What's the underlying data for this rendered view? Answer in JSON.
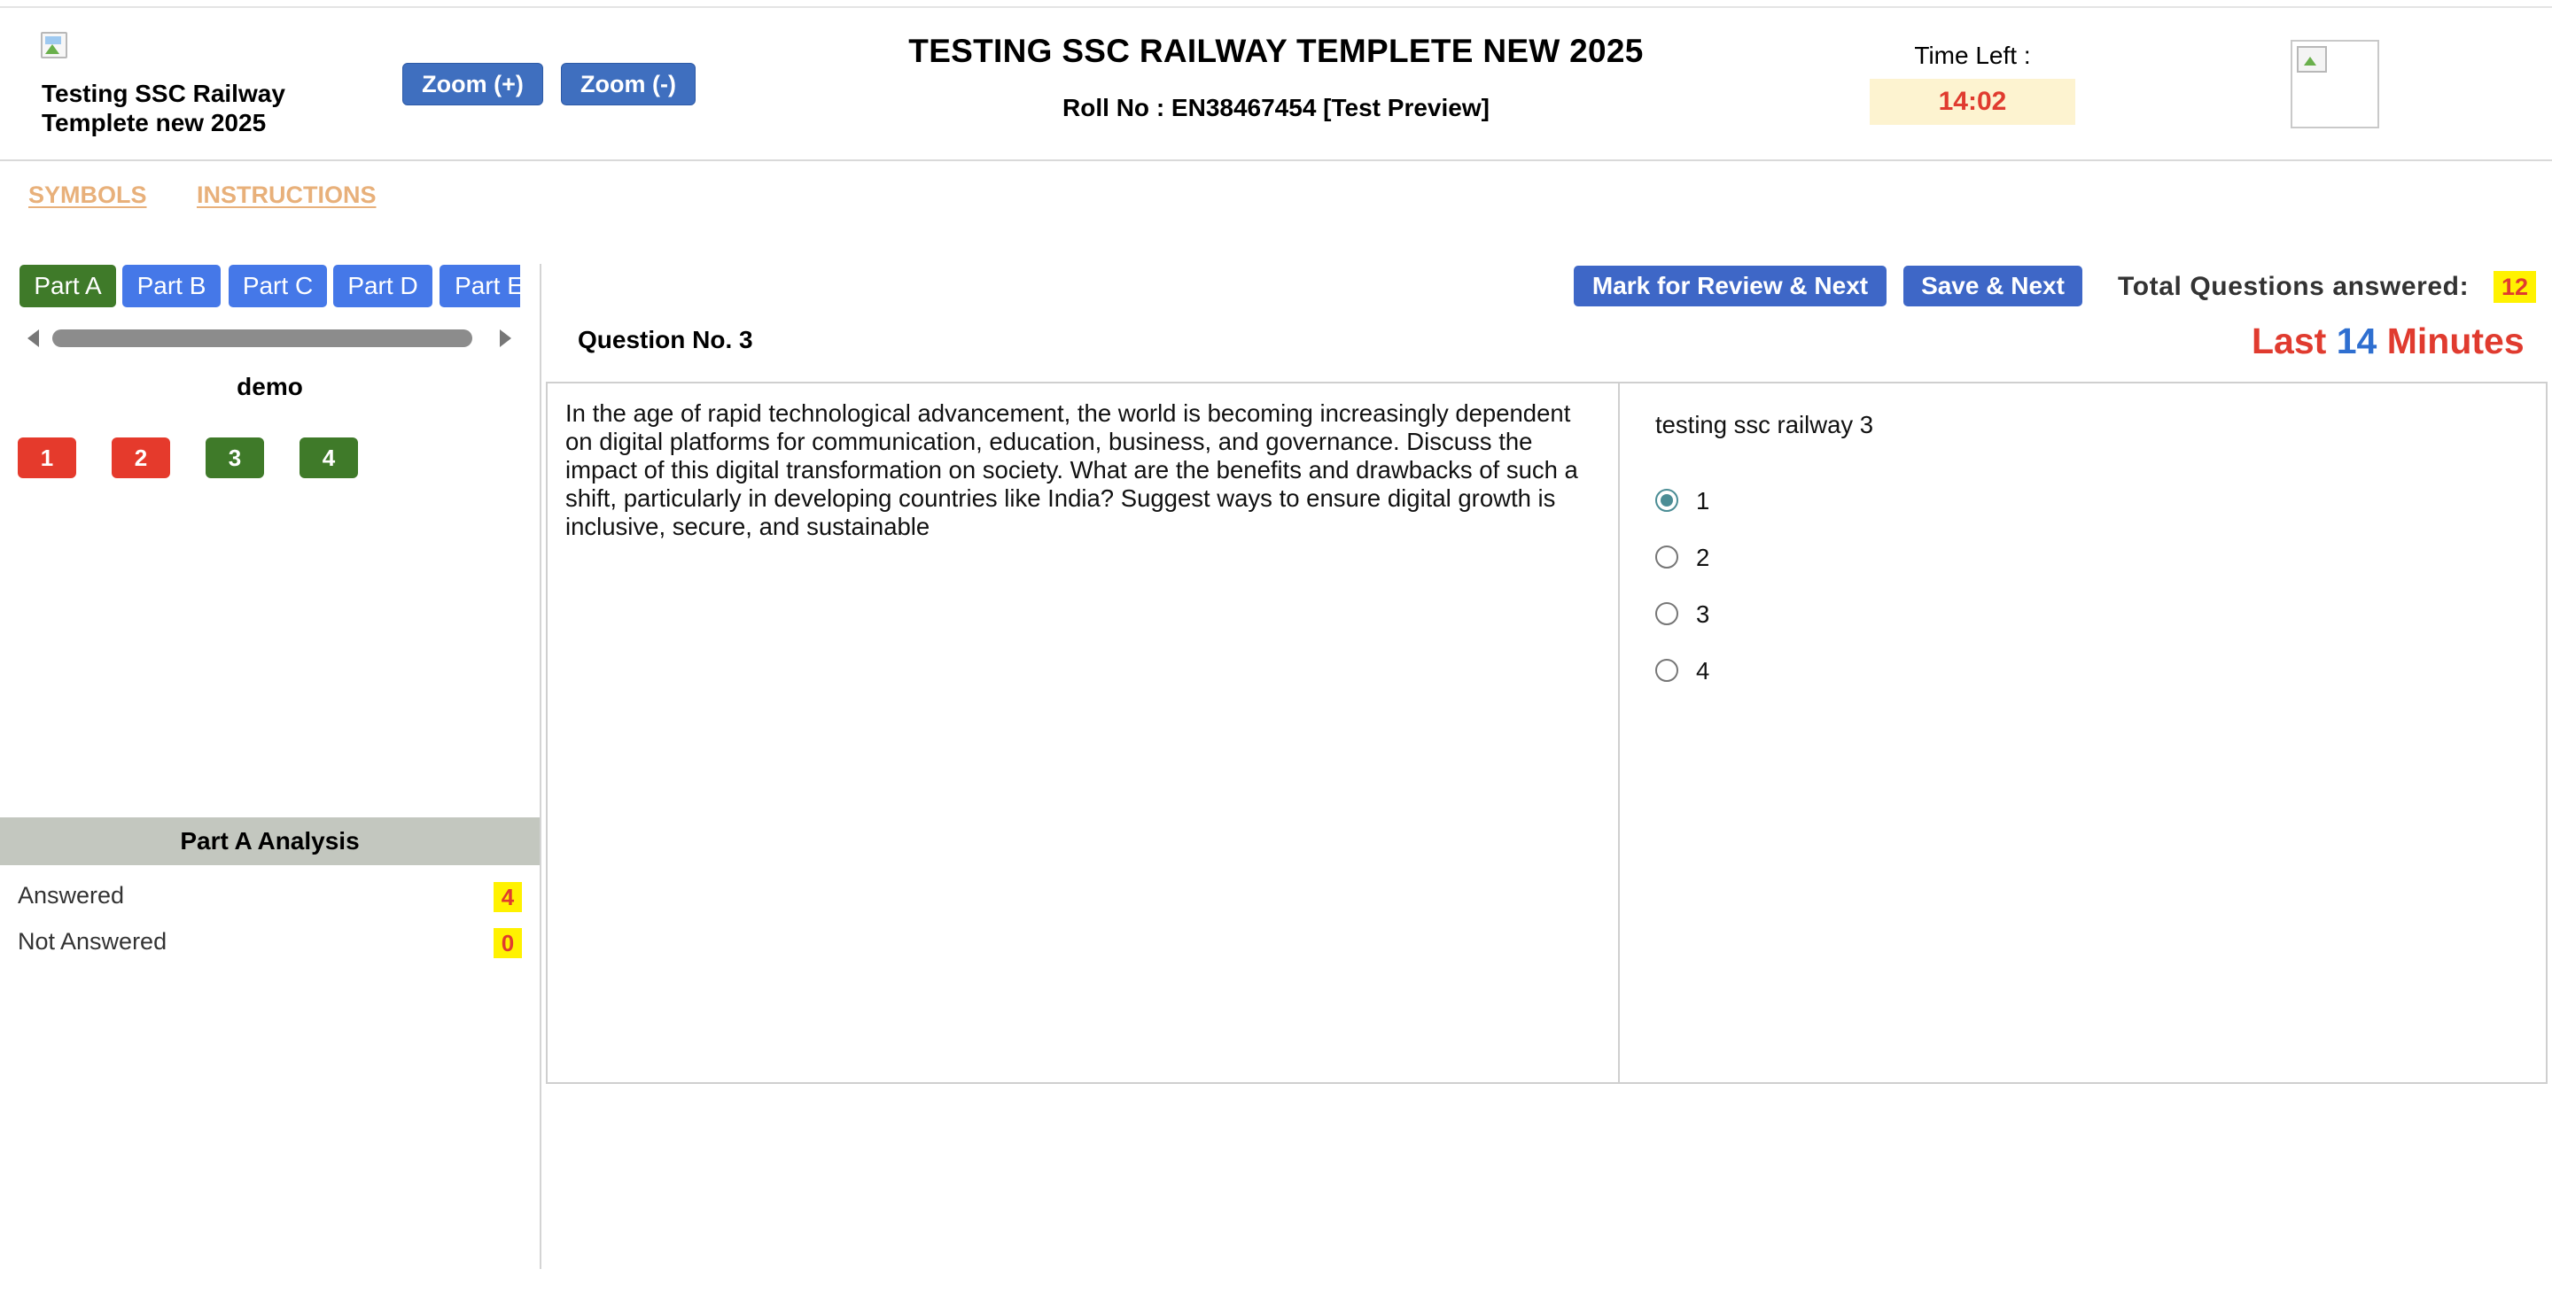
{
  "header": {
    "exam_short_title": "Testing SSC Railway Templete new 2025",
    "zoom_in_label": "Zoom (+)",
    "zoom_out_label": "Zoom (-)",
    "exam_title": "TESTING SSC RAILWAY TEMPLETE NEW 2025",
    "roll_no": "Roll No : EN38467454 [Test Preview]",
    "time_left_label": "Time Left :",
    "time_left_value": "14:02"
  },
  "links": {
    "symbols": "SYMBOLS",
    "instructions": "INSTRUCTIONS"
  },
  "sidebar": {
    "parts": [
      {
        "label": "Part A",
        "active": true
      },
      {
        "label": "Part B",
        "active": false
      },
      {
        "label": "Part C",
        "active": false
      },
      {
        "label": "Part D",
        "active": false
      },
      {
        "label": "Part E",
        "active": false
      }
    ],
    "section_name": "demo",
    "questions": [
      {
        "number": "1",
        "status": "not-answered",
        "color": "#e53a2c"
      },
      {
        "number": "2",
        "status": "not-answered",
        "color": "#e53a2c"
      },
      {
        "number": "3",
        "status": "answered",
        "color": "#3f7a29"
      },
      {
        "number": "4",
        "status": "answered",
        "color": "#3f7a29"
      }
    ],
    "analysis": {
      "title": "Part A Analysis",
      "answered_label": "Answered",
      "answered_count": "4",
      "not_answered_label": "Not Answered",
      "not_answered_count": "0"
    }
  },
  "actions": {
    "mark_review_label": "Mark for Review & Next",
    "save_next_label": "Save & Next",
    "total_answered_label": "Total Questions answered:",
    "total_answered_count": "12"
  },
  "question": {
    "number_label": "Question No. 3",
    "last_minutes_prefix": "Last",
    "last_minutes_value": "14",
    "last_minutes_suffix": "Minutes",
    "text": "In the age of rapid technological advancement, the world is becoming increasingly dependent on digital platforms for communication, education, business, and governance. Discuss the impact of this digital transformation on society. What are the benefits and drawbacks of such a shift, particularly in developing countries like India? Suggest ways to ensure digital growth is inclusive, secure, and sustainable",
    "options_title": "testing ssc railway 3",
    "options": [
      {
        "label": "1",
        "selected": true
      },
      {
        "label": "2",
        "selected": false
      },
      {
        "label": "3",
        "selected": false
      },
      {
        "label": "4",
        "selected": false
      }
    ]
  },
  "colors": {
    "primary_button": "#3e67c7",
    "active_part": "#3f7a29",
    "inactive_part": "#4578e8",
    "alert_red": "#e03b2f",
    "highlight_yellow": "#fff200",
    "link_orange": "#e8b07a"
  }
}
